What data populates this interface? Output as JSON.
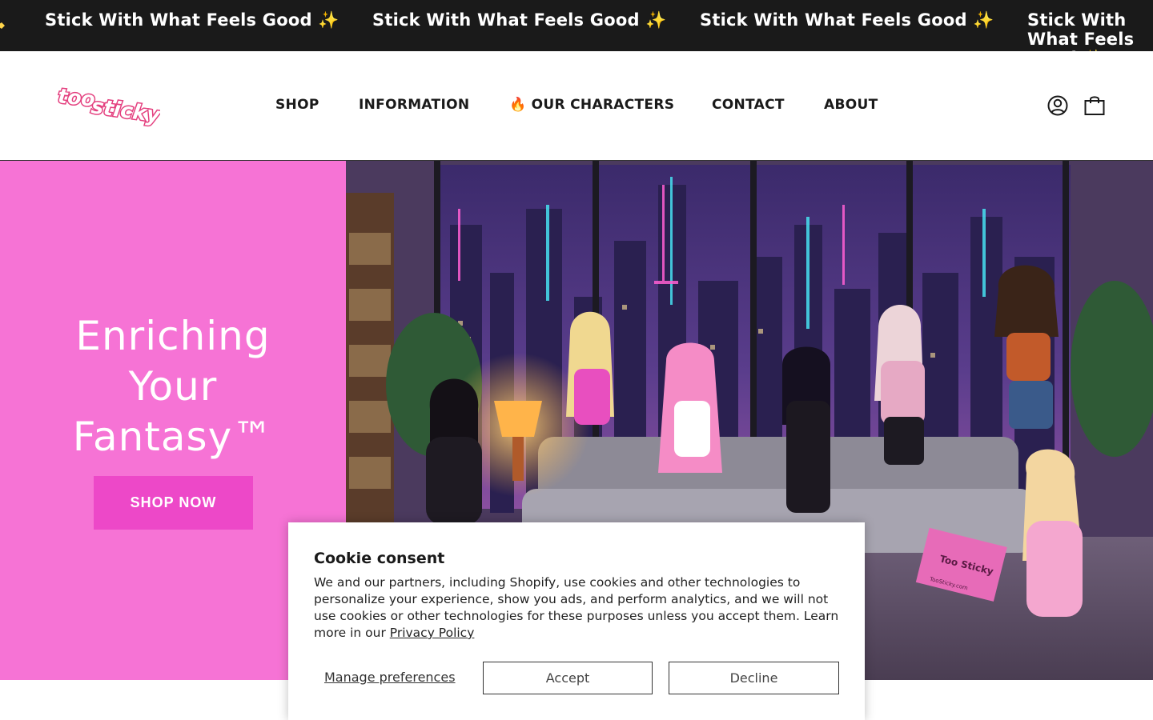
{
  "announcement": {
    "items": [
      "Stick With What Feels Good ✨",
      "Stick With What Feels Good ✨",
      "Stick With What Feels Good ✨",
      "Stick With What Feels Good ✨"
    ]
  },
  "header": {
    "logo_text": "too sticky",
    "nav": [
      "SHOP",
      "INFORMATION",
      "🔥 OUR CHARACTERS",
      "CONTACT",
      "ABOUT"
    ]
  },
  "hero": {
    "title_lines": [
      "Enriching",
      "Your",
      "Fantasy™"
    ],
    "cta_label": "SHOP NOW",
    "image_box_text": "Too Sticky",
    "image_box_subtext": "TooSticky.com"
  },
  "cookie": {
    "title": "Cookie consent",
    "body": "We and our partners, including Shopify, use cookies and other technologies to personalize your experience, show you ads, and perform analytics, and we will not use cookies or other technologies for these purposes unless you accept them. Learn more in our ",
    "policy_link": "Privacy Policy",
    "manage_label": "Manage preferences",
    "accept_label": "Accept",
    "decline_label": "Decline"
  },
  "colors": {
    "hero_pink": "#f673d5",
    "cta_pink": "#ed48c8",
    "announce_bg": "#1a1a1a"
  }
}
